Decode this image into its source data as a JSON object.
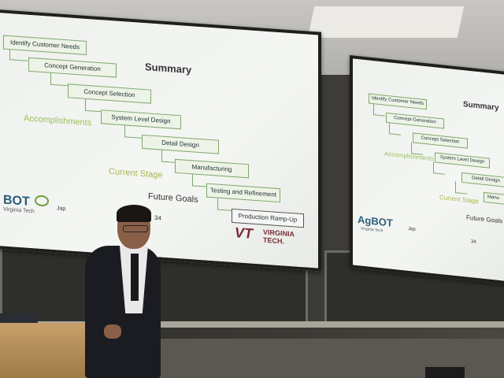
{
  "left_slide": {
    "title": "Summary",
    "steps": [
      "Identify Customer Needs",
      "Concept Generation",
      "Concept Selection",
      "System Level Design",
      "Detail Design",
      "Manufacturing",
      "Testing and Refinement",
      "Production Ramp-Up"
    ],
    "accomplishments": "Accomplishments",
    "current_stage": "Current Stage",
    "future_goals": "Future Goals",
    "page_number": "34",
    "logo_text": "BOT",
    "logo_sub": "Virginia Tech",
    "presenter": "Jap",
    "vt_mark": "VT",
    "vt_text_1": "VIRGINIA",
    "vt_text_2": "TECH."
  },
  "right_slide": {
    "title": "Summary",
    "steps": [
      "Identify Customer Needs",
      "Concept Generation",
      "Concept Selection",
      "System Level Design",
      "Detail Design",
      "Manu"
    ],
    "accomplishments": "Accomplishments",
    "current_stage": "Current Stage",
    "future_goals": "Future Goals",
    "page_number": "34",
    "logo_text": "AgBOT",
    "logo_sub": "Virginia Tech",
    "presenter": "Jap"
  }
}
